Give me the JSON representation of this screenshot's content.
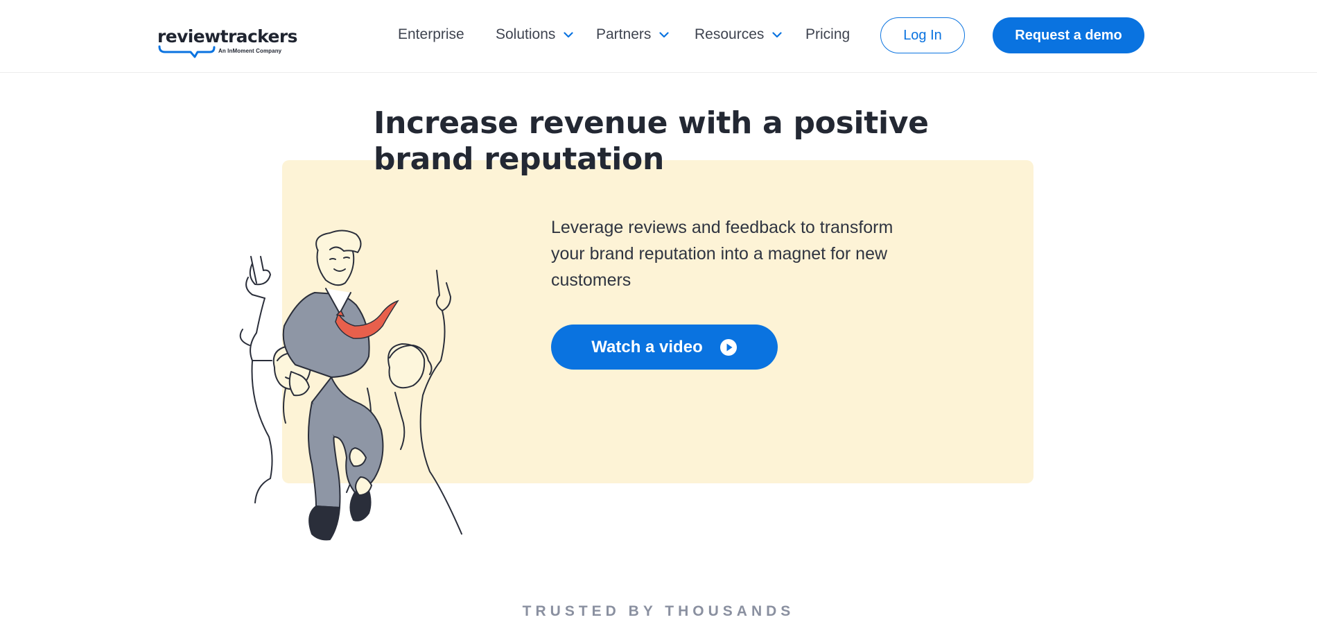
{
  "brand": {
    "name": "reviewtrackers",
    "tagline": "An InMoment Company",
    "primary_color": "#0a73e0",
    "hero_bg_color": "#fdf3d6"
  },
  "nav": {
    "items": [
      {
        "label": "Enterprise",
        "has_dropdown": false
      },
      {
        "label": "Solutions",
        "has_dropdown": true
      },
      {
        "label": "Partners",
        "has_dropdown": true
      },
      {
        "label": "Resources",
        "has_dropdown": true
      },
      {
        "label": "Pricing",
        "has_dropdown": false
      }
    ],
    "login_label": "Log In",
    "demo_label": "Request a demo"
  },
  "hero": {
    "title": "Increase revenue with a positive brand reputation",
    "description": "Leverage reviews and feedback to transform your brand reputation into a magnet for new customers",
    "video_label": "Watch a video",
    "illustration_icon": "celebration-illustration"
  },
  "trusted": {
    "label": "TRUSTED BY THOUSANDS"
  }
}
